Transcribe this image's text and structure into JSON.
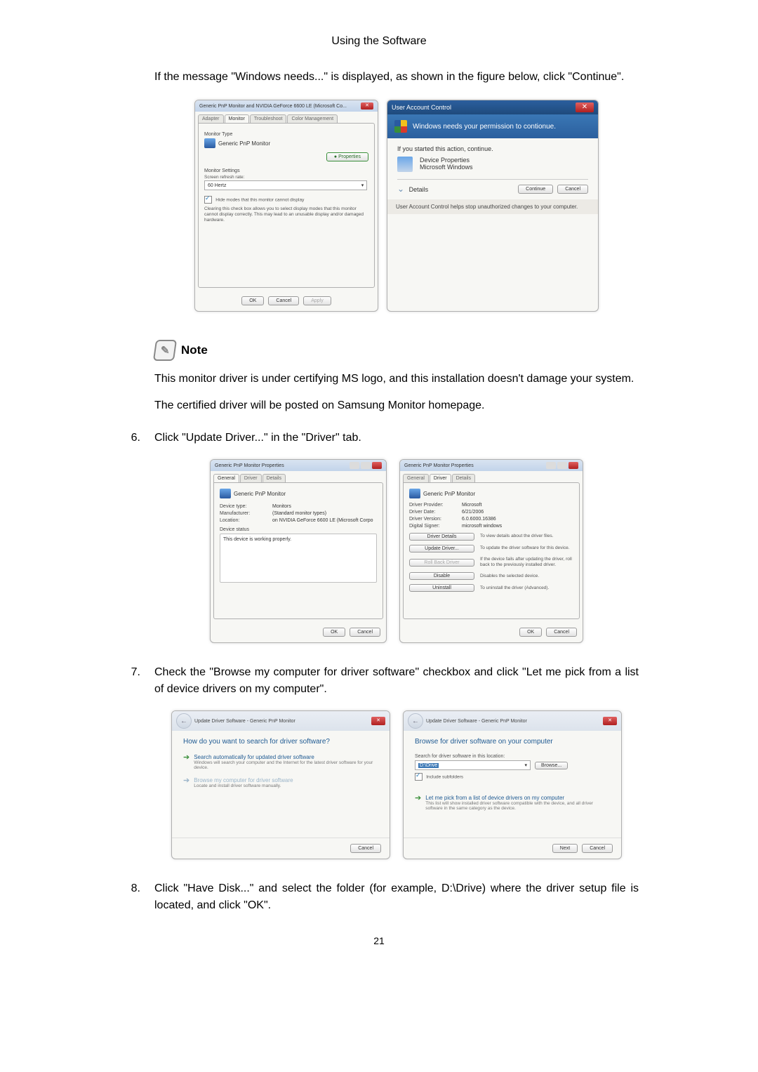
{
  "header": {
    "title": "Using the Software"
  },
  "intro": {
    "text": "If the message \"Windows needs...\" is displayed, as shown in the figure below, click \"Continue\"."
  },
  "monitor_dialog": {
    "title": "Generic PnP Monitor and NVIDIA GeForce 6600 LE (Microsoft Co...",
    "tabs": {
      "adapter": "Adapter",
      "monitor": "Monitor",
      "troubleshoot": "Troubleshoot",
      "color": "Color Management"
    },
    "monitor_type_label": "Monitor Type",
    "monitor_name": "Generic PnP Monitor",
    "properties_btn": "Properties",
    "settings_label": "Monitor Settings",
    "refresh_label": "Screen refresh rate:",
    "refresh_value": "60 Hertz",
    "hide_modes_label": "Hide modes that this monitor cannot display",
    "hide_modes_note": "Clearing this check box allows you to select display modes that this monitor cannot display correctly. This may lead to an unusable display and/or damaged hardware.",
    "ok": "OK",
    "cancel": "Cancel",
    "apply": "Apply"
  },
  "uac": {
    "title": "User Account Control",
    "banner": "Windows needs your permission to contionue.",
    "started": "If you started this action, continue.",
    "app_name": "Device Properties",
    "publisher": "Microsoft Windows",
    "details": "Details",
    "continue": "Continue",
    "cancel": "Cancel",
    "footer": "User Account Control helps stop unauthorized changes to your computer."
  },
  "note": {
    "label": "Note",
    "line1": "This monitor driver is under certifying MS logo, and this installation doesn't damage your system.",
    "line2": "The certified driver will be posted on Samsung Monitor homepage."
  },
  "steps": {
    "s6_num": "6.",
    "s6_text": "Click \"Update Driver...\" in the \"Driver\" tab.",
    "s7_num": "7.",
    "s7_text": "Check the \"Browse my computer for driver software\" checkbox and click \"Let me pick from a list of device drivers on my computer\".",
    "s8_num": "8.",
    "s8_text": "Click \"Have Disk...\" and select the folder (for example, D:\\Drive) where the driver setup file is located, and click \"OK\"."
  },
  "props_general": {
    "title": "Generic PnP Monitor Properties",
    "tabs": {
      "general": "General",
      "driver": "Driver",
      "details": "Details"
    },
    "name": "Generic PnP Monitor",
    "device_type": {
      "k": "Device type:",
      "v": "Monitors"
    },
    "manufacturer": {
      "k": "Manufacturer:",
      "v": "(Standard monitor types)"
    },
    "location": {
      "k": "Location:",
      "v": "on NVIDIA GeForce 6600 LE (Microsoft Corpo"
    },
    "status_label": "Device status",
    "status_text": "This device is working properly.",
    "ok": "OK",
    "cancel": "Cancel"
  },
  "props_driver": {
    "title": "Generic PnP Monitor Properties",
    "tabs": {
      "general": "General",
      "driver": "Driver",
      "details": "Details"
    },
    "name": "Generic PnP Monitor",
    "provider": {
      "k": "Driver Provider:",
      "v": "Microsoft"
    },
    "date": {
      "k": "Driver Date:",
      "v": "6/21/2006"
    },
    "version": {
      "k": "Driver Version:",
      "v": "6.0.6000.16386"
    },
    "signer": {
      "k": "Digital Signer:",
      "v": "microsoft windows"
    },
    "btn_details": {
      "label": "Driver Details",
      "desc": "To view details about the driver files."
    },
    "btn_update": {
      "label": "Update Driver...",
      "desc": "To update the driver software for this device."
    },
    "btn_rollback": {
      "label": "Roll Back Driver",
      "desc": "If the device fails after updating the driver, roll back to the previously installed driver."
    },
    "btn_disable": {
      "label": "Disable",
      "desc": "Disables the selected device."
    },
    "btn_uninstall": {
      "label": "Uninstall",
      "desc": "To uninstall the driver (Advanced)."
    },
    "ok": "OK",
    "cancel": "Cancel"
  },
  "wizard_search": {
    "breadcrumb": "Update Driver Software - Generic PnP Monitor",
    "heading": "How do you want to search for driver software?",
    "opt1_title": "Search automatically for updated driver software",
    "opt1_sub": "Windows will search your computer and the Internet for the latest driver software for your device.",
    "opt2_title": "Browse my computer for driver software",
    "opt2_sub": "Locate and install driver software manually.",
    "cancel": "Cancel"
  },
  "wizard_browse": {
    "breadcrumb": "Update Driver Software - Generic PnP Monitor",
    "heading": "Browse for driver software on your computer",
    "search_label": "Search for driver software in this location:",
    "path_value": "D:\\Drive",
    "browse_btn": "Browse...",
    "include_sub": "Include subfolders",
    "pick_title": "Let me pick from a list of device drivers on my computer",
    "pick_sub": "This list will show installed driver software compatible with the device, and all driver software in the same category as the device.",
    "next": "Next",
    "cancel": "Cancel"
  },
  "page_number": "21"
}
